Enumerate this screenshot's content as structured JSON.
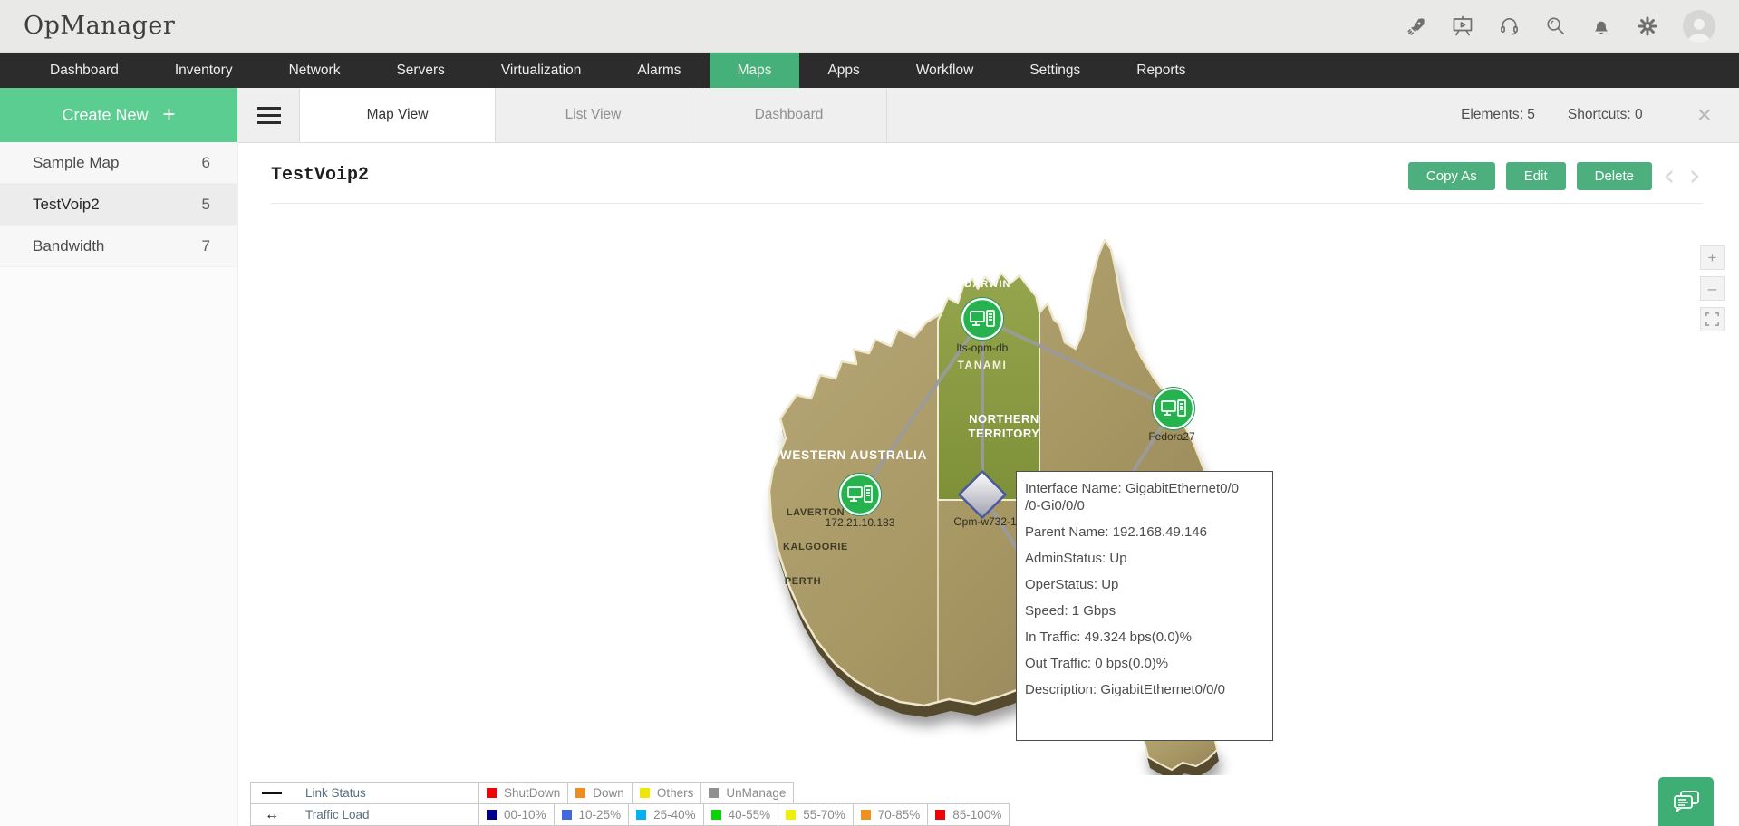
{
  "header": {
    "logo": "OpManager",
    "icons": [
      "rocket-icon",
      "presentation-icon",
      "headset-icon",
      "search-icon",
      "bell-icon",
      "gear-icon",
      "avatar"
    ]
  },
  "nav": {
    "items": [
      {
        "label": "Dashboard",
        "active": false
      },
      {
        "label": "Inventory",
        "active": false
      },
      {
        "label": "Network",
        "active": false
      },
      {
        "label": "Servers",
        "active": false
      },
      {
        "label": "Virtualization",
        "active": false
      },
      {
        "label": "Alarms",
        "active": false
      },
      {
        "label": "Maps",
        "active": true
      },
      {
        "label": "Apps",
        "active": false
      },
      {
        "label": "Workflow",
        "active": false
      },
      {
        "label": "Settings",
        "active": false
      },
      {
        "label": "Reports",
        "active": false
      }
    ]
  },
  "sidebar": {
    "create_label": "Create New",
    "create_plus": "+",
    "maps": [
      {
        "name": "Sample Map",
        "count": "6",
        "selected": false
      },
      {
        "name": "TestVoip2",
        "count": "5",
        "selected": true
      },
      {
        "name": "Bandwidth",
        "count": "7",
        "selected": false
      }
    ]
  },
  "tabs": {
    "items": [
      "Map View",
      "List View",
      "Dashboard"
    ],
    "elements": "Elements: 5",
    "shortcuts": "Shortcuts: 0",
    "close": "×"
  },
  "toolbar": {
    "title": "TestVoip2",
    "copy_as": "Copy As",
    "edit": "Edit",
    "delete": "Delete",
    "pager": "‹ ›"
  },
  "map": {
    "regions": {
      "darwin": "DARWIN",
      "tanami": "TANAMI",
      "nt_line1": "NORTHERN",
      "nt_line2": "TERRITORY",
      "wa": "WESTERN AUSTRALIA",
      "laverton": "LAVERTON",
      "kalgoorie": "KALGOORIE",
      "perth": "PERTH"
    },
    "nodes": {
      "darwin_device": "lts-opm-db",
      "fedora_device": "Fedora27",
      "laverton_device": "172.21.10.183",
      "diamond_device": "Opm-w732-1"
    }
  },
  "tooltip": {
    "lines": [
      "Interface Name: GigabitEthernet0/0",
      "/0-Gi0/0/0",
      "Parent Name: 192.168.49.146",
      "AdminStatus: Up",
      "OperStatus: Up",
      "Speed: 1 Gbps",
      "In Traffic: 49.324 bps(0.0)%",
      "Out Traffic: 0 bps(0.0)%",
      "Description: GigabitEthernet0/0/0"
    ]
  },
  "zoom_controls": {
    "zoom_in": "+",
    "zoom_out": "–"
  },
  "legend": {
    "rows": [
      {
        "label": "Link Status",
        "items": [
          {
            "label": "ShutDown",
            "color": "#ee0404"
          },
          {
            "label": "Down",
            "color": "#ef8d1f"
          },
          {
            "label": "Others",
            "color": "#efe607"
          },
          {
            "label": "UnManage",
            "color": "#8f8f8f"
          }
        ]
      },
      {
        "label": "Traffic Load",
        "items": [
          {
            "label": "00-10%",
            "color": "#00008b"
          },
          {
            "label": "10-25%",
            "color": "#4169dd"
          },
          {
            "label": "25-40%",
            "color": "#00b3f0"
          },
          {
            "label": "40-55%",
            "color": "#0ad406"
          },
          {
            "label": "55-70%",
            "color": "#eff007"
          },
          {
            "label": "70-85%",
            "color": "#f0911e"
          },
          {
            "label": "85-100%",
            "color": "#ee0404"
          }
        ]
      }
    ]
  },
  "colors": {
    "accent_green": "#46b07a",
    "button_green": "#4caf7d",
    "create_green": "#5bcd90",
    "navbar_dark": "#2c2c2c",
    "land_tan": "#a79763",
    "land_olive": "#8d9c45",
    "node_green": "#26b24e"
  }
}
